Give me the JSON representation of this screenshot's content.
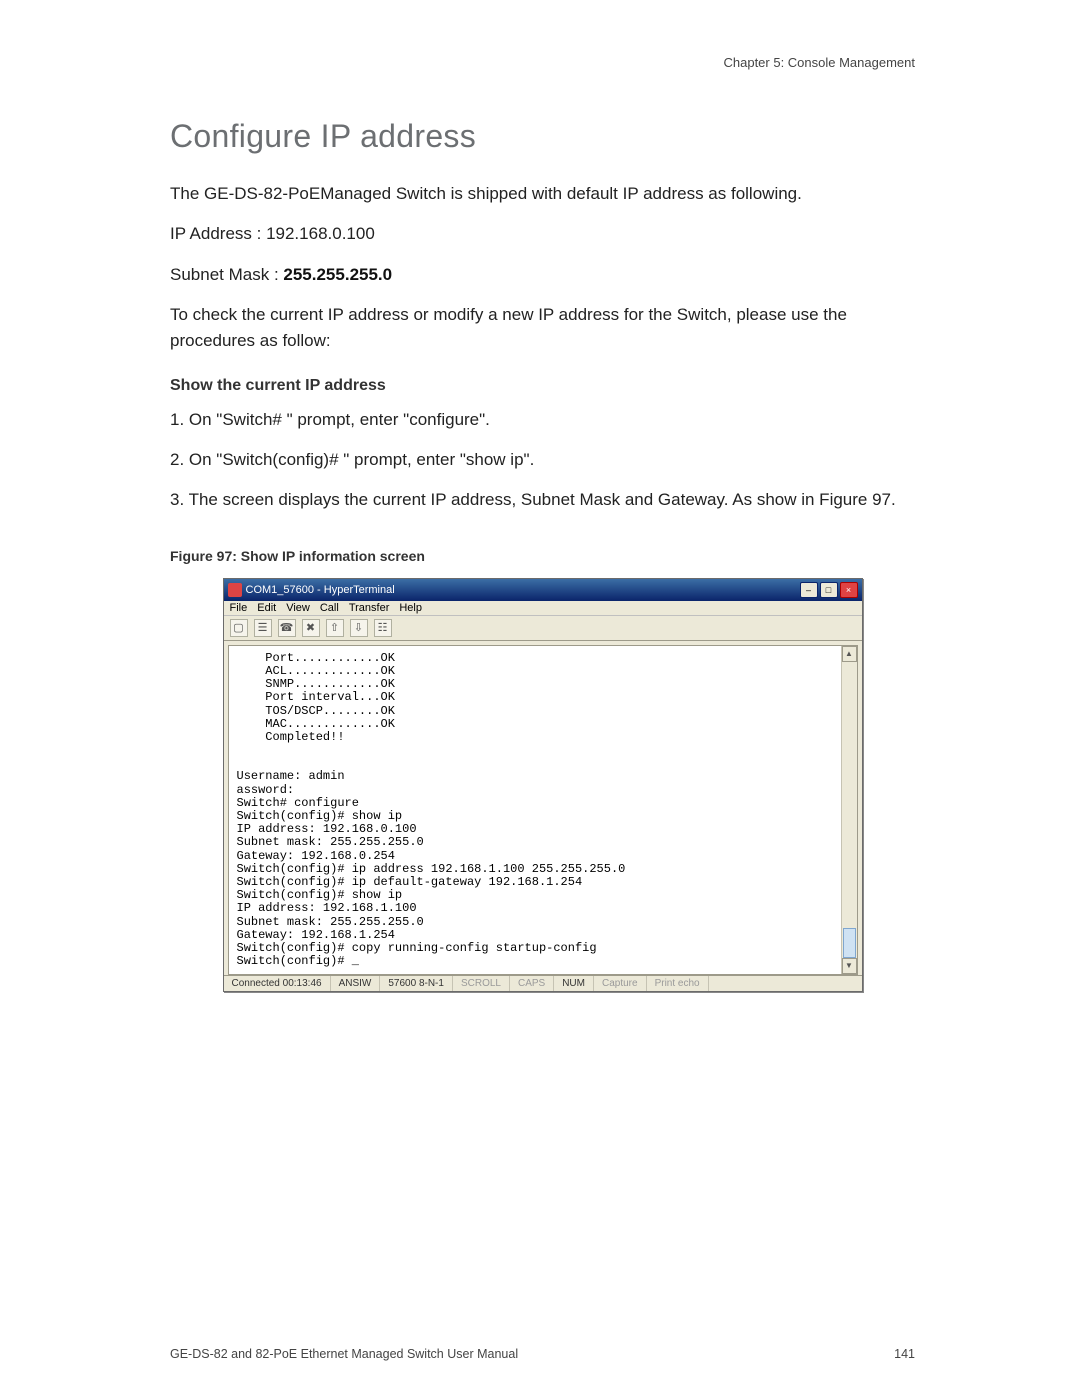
{
  "header": {
    "chapter": "Chapter 5: Console Management"
  },
  "title": "Configure IP address",
  "paragraphs": {
    "intro": "The GE-DS-82-PoEManaged Switch is shipped with default IP address as following.",
    "ip_line": "IP Address : 192.168.0.100",
    "subnet_prefix": "Subnet Mask : ",
    "subnet_value": "255.255.255.0",
    "para2": "To check the current IP address or modify a new IP address for the Switch, please use the procedures as follow:",
    "sub_heading": "Show the current IP address",
    "step1": "1. On \"Switch# \" prompt, enter \"configure\".",
    "step2": "2. On \"Switch(config)# \" prompt, enter \"show ip\".",
    "step3": "3. The screen displays the current IP address, Subnet Mask and Gateway. As show in Figure 97.",
    "fig_caption": "Figure 97: Show IP information screen"
  },
  "hyperterminal": {
    "title": "COM1_57600 - HyperTerminal",
    "menus": [
      "File",
      "Edit",
      "View",
      "Call",
      "Transfer",
      "Help"
    ],
    "toolbar_icons": [
      "new-icon",
      "open-icon",
      "connect-icon",
      "disconnect-icon",
      "send-icon",
      "receive-icon",
      "properties-icon"
    ],
    "terminal_lines": "    Port............OK\n    ACL.............OK\n    SNMP............OK\n    Port interval...OK\n    TOS/DSCP........OK\n    MAC.............OK\n    Completed!!\n\n\nUsername: admin\nassword:\nSwitch# configure\nSwitch(config)# show ip\nIP address: 192.168.0.100\nSubnet mask: 255.255.255.0\nGateway: 192.168.0.254\nSwitch(config)# ip address 192.168.1.100 255.255.255.0\nSwitch(config)# ip default-gateway 192.168.1.254\nSwitch(config)# show ip\nIP address: 192.168.1.100\nSubnet mask: 255.255.255.0\nGateway: 192.168.1.254\nSwitch(config)# copy running-config startup-config\nSwitch(config)# _",
    "status": {
      "connected": "Connected 00:13:46",
      "emulation": "ANSIW",
      "settings": "57600 8-N-1",
      "scroll": "SCROLL",
      "caps": "CAPS",
      "num": "NUM",
      "capture": "Capture",
      "print_echo": "Print echo"
    }
  },
  "footer": {
    "manual": "GE-DS-82 and 82-PoE Ethernet Managed Switch User Manual",
    "page_number": "141"
  }
}
